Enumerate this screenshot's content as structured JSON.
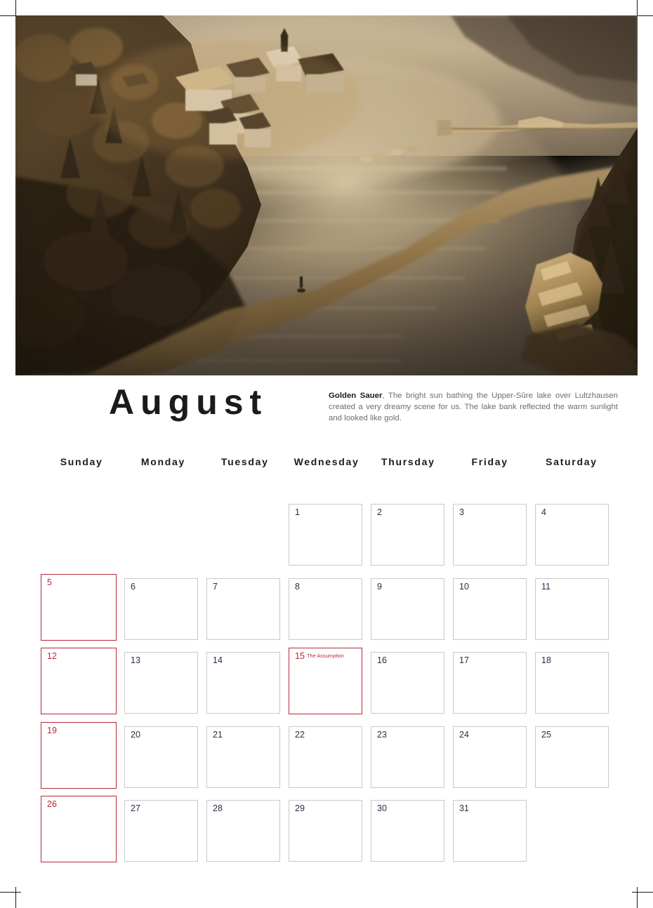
{
  "page": {
    "month_title": "August",
    "crop_marks": true
  },
  "photo": {
    "alt_name": "upper-sure-lake-sunset-photo",
    "description": "Aerial view of Lultzhausen village on a wooded hillside above the golden sunlit Upper-Sûre lake, with a pier crossing the water and a sunlit rocky shoreline at right",
    "palette": {
      "sky_water_light": "#d8cbb4",
      "water_mid": "#a99madjust",
      "water_dark": "#4a4238",
      "forest_dark": "#2b2217",
      "forest_mid": "#5a452c",
      "autumn_warm": "#8a6436",
      "sunlit_gold": "#d9b77a",
      "roof_white": "#efe6d4"
    }
  },
  "caption": {
    "lead": "Golden Sauer",
    "body": ", The bright sun bathing the Upper-Sûre lake over Lultzhausen created a very dreamy scene for us. The lake bank reflected the warm sunlight and looked like gold."
  },
  "weekdays": [
    "Sunday",
    "Monday",
    "Tuesday",
    "Wednesday",
    "Thursday",
    "Friday",
    "Saturday"
  ],
  "colors": {
    "sunday_red": "#b92838",
    "weekday_border": "#c9c9c9",
    "day_number": "#22304a",
    "title": "#1b1b1b",
    "caption_text": "#6d6d6d"
  },
  "calendar": {
    "weeks": [
      [
        {
          "day": "",
          "empty": true
        },
        {
          "day": "",
          "empty": true
        },
        {
          "day": "",
          "empty": true
        },
        {
          "day": "1",
          "empty": false
        },
        {
          "day": "2",
          "empty": false
        },
        {
          "day": "3",
          "empty": false
        },
        {
          "day": "4",
          "empty": false
        }
      ],
      [
        {
          "day": "5",
          "empty": false
        },
        {
          "day": "6",
          "empty": false
        },
        {
          "day": "7",
          "empty": false
        },
        {
          "day": "8",
          "empty": false
        },
        {
          "day": "9",
          "empty": false
        },
        {
          "day": "10",
          "empty": false
        },
        {
          "day": "11",
          "empty": false
        }
      ],
      [
        {
          "day": "12",
          "empty": false
        },
        {
          "day": "13",
          "empty": false
        },
        {
          "day": "14",
          "empty": false
        },
        {
          "day": "15",
          "empty": false,
          "event": "The Assumption",
          "holiday": true
        },
        {
          "day": "16",
          "empty": false
        },
        {
          "day": "17",
          "empty": false
        },
        {
          "day": "18",
          "empty": false
        }
      ],
      [
        {
          "day": "19",
          "empty": false
        },
        {
          "day": "20",
          "empty": false
        },
        {
          "day": "21",
          "empty": false
        },
        {
          "day": "22",
          "empty": false
        },
        {
          "day": "23",
          "empty": false
        },
        {
          "day": "24",
          "empty": false
        },
        {
          "day": "25",
          "empty": false
        }
      ],
      [
        {
          "day": "26",
          "empty": false
        },
        {
          "day": "27",
          "empty": false
        },
        {
          "day": "28",
          "empty": false
        },
        {
          "day": "29",
          "empty": false
        },
        {
          "day": "30",
          "empty": false
        },
        {
          "day": "31",
          "empty": false
        },
        {
          "day": "",
          "empty": true
        }
      ]
    ]
  }
}
